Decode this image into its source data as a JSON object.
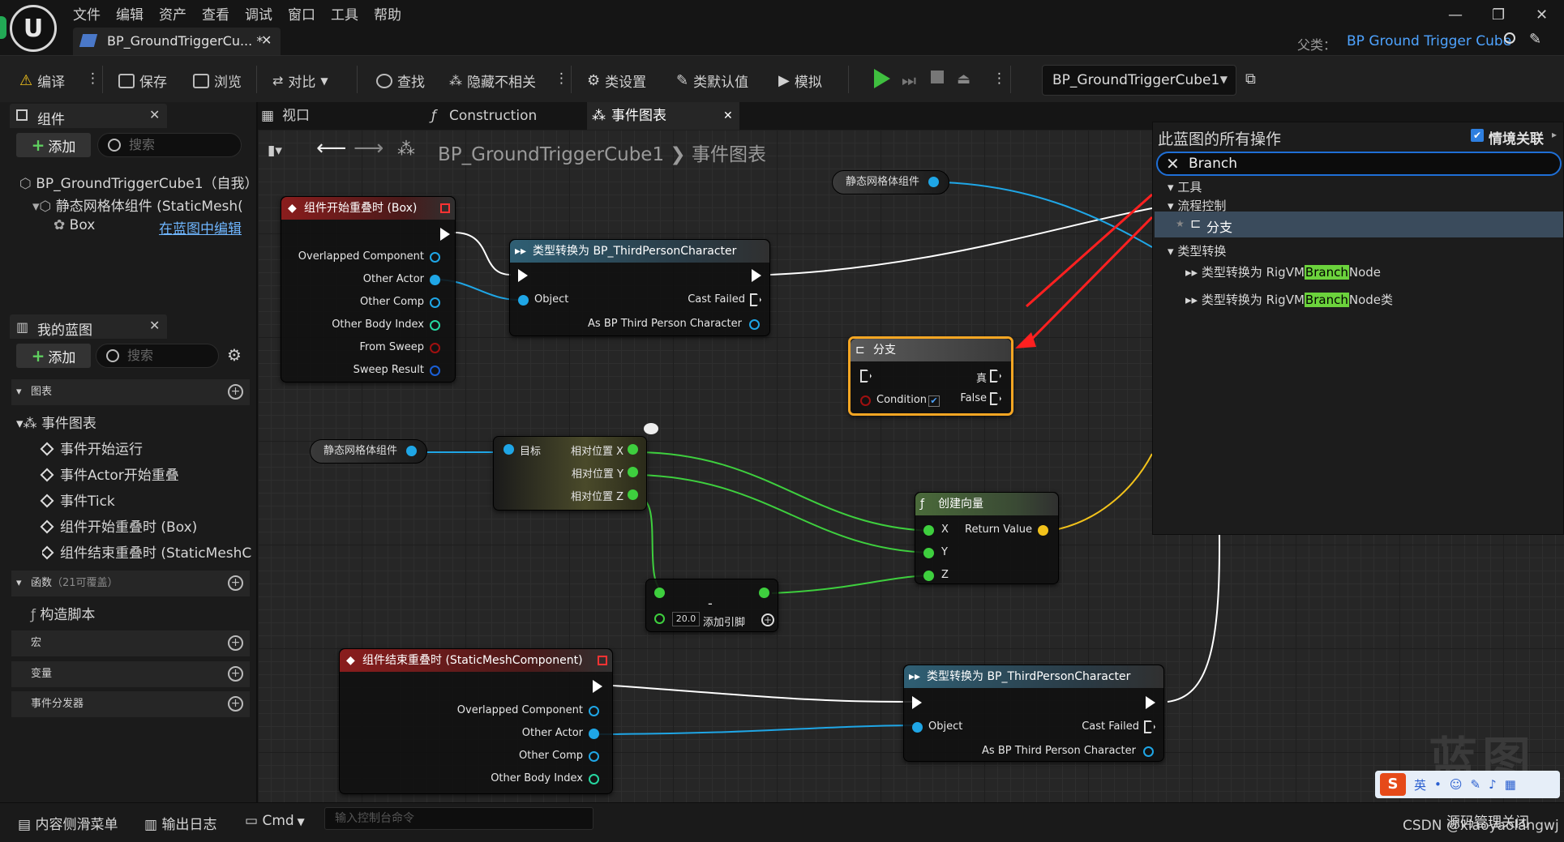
{
  "window": {
    "menu": [
      "文件",
      "编辑",
      "资产",
      "查看",
      "调试",
      "窗口",
      "工具",
      "帮助"
    ],
    "tab_title": "BP_GroundTriggerCu... *",
    "parent_label": "父类：",
    "parent_value": "BP Ground Trigger Cube"
  },
  "toolbar": {
    "compile": "编译",
    "save": "保存",
    "browse": "浏览",
    "diff": "对比",
    "find": "查找",
    "hide_unrelated": "隐藏不相关",
    "class_settings": "类设置",
    "class_defaults": "类默认值",
    "simulate": "模拟",
    "debug_object": "BP_GroundTriggerCube1"
  },
  "components_panel": {
    "title": "组件",
    "add": "添加",
    "search_placeholder": "搜索",
    "items": [
      "BP_GroundTriggerCube1（自我）",
      "静态网格体组件 (StaticMesh(",
      "Box"
    ],
    "edit_link": "在蓝图中编辑"
  },
  "my_blueprint": {
    "title": "我的蓝图",
    "add": "添加",
    "search_placeholder": "搜索",
    "graphs_label": "图表",
    "event_graph": "事件图表",
    "events": [
      "事件开始运行",
      "事件Actor开始重叠",
      "事件Tick",
      "组件开始重叠时 (Box)",
      "组件结束重叠时 (StaticMeshCo"
    ],
    "functions_label": "函数",
    "functions_count": "（21可覆盖）",
    "construction_script": "构造脚本",
    "macros_label": "宏",
    "variables_label": "变量",
    "dispatchers_label": "事件分发器"
  },
  "graph_tabs": [
    "视口",
    "Construction S...",
    "事件图表"
  ],
  "breadcrumb": {
    "blueprint": "BP_GroundTriggerCube1",
    "graph": "事件图表"
  },
  "nodes": {
    "begin_overlap": {
      "title": "组件开始重叠时 (Box)",
      "pins": [
        "Overlapped Component",
        "Other Actor",
        "Other Comp",
        "Other Body Index",
        "From Sweep",
        "Sweep Result"
      ]
    },
    "cast1": {
      "title": "类型转换为 BP_ThirdPersonCharacter",
      "object": "Object",
      "cast_failed": "Cast Failed",
      "as": "As BP Third Person Character"
    },
    "static_mesh_top": "静态网格体组件",
    "static_mesh_mid": "静态网格体组件",
    "branch": {
      "title": "分支",
      "true": "真",
      "condition": "Condition",
      "false": "False"
    },
    "rel_loc": {
      "target": "目标",
      "x": "相对位置 X",
      "y": "相对位置 Y",
      "z": "相对位置 Z"
    },
    "make_vector": {
      "title": "创建向量",
      "x": "X",
      "y": "Y",
      "z": "Z",
      "ret": "Return Value"
    },
    "minus": {
      "symbol": "-",
      "value": "20.0",
      "add_pin": "添加引脚"
    },
    "end_overlap": {
      "title": "组件结束重叠时 (StaticMeshComponent)",
      "pins": [
        "Overlapped Component",
        "Other Actor",
        "Other Comp",
        "Other Body Index"
      ]
    },
    "cast2": {
      "title": "类型转换为 BP_ThirdPersonCharacter",
      "object": "Object",
      "cast_failed": "Cast Failed",
      "as": "As BP Third Person Character"
    }
  },
  "action_menu": {
    "title": "此蓝图的所有操作",
    "context_label": "情境关联",
    "search_value": "Branch",
    "cat_tools": "工具",
    "cat_flow": "流程控制",
    "branch_item": "分支",
    "cat_cast": "类型转换",
    "cast_items": [
      {
        "pre": "类型转换为 RigVM",
        "hit": "Branch",
        "post": "Node"
      },
      {
        "pre": "类型转换为 RigVM",
        "hit": "Branch",
        "post": "Node类"
      }
    ]
  },
  "watermark": "蓝图",
  "bottom": {
    "content_drawer": "内容侧滑菜单",
    "output_log": "输出日志",
    "cmd": "Cmd",
    "cmd_placeholder": "输入控制台命令",
    "source_control": "源码管理关闭",
    "credit": "CSDN @xiaoyaolangwj"
  },
  "ime": {
    "logo": "S",
    "mode": "英"
  },
  "colors": {
    "accent": "#1f6fd6",
    "highlight": "#6bd23c",
    "exec_wire": "#ffffff",
    "object_pin": "#1fa6e6",
    "float_pin": "#3ecf3e",
    "vector_pin": "#f2c21b",
    "branch_border": "#f5a623"
  }
}
